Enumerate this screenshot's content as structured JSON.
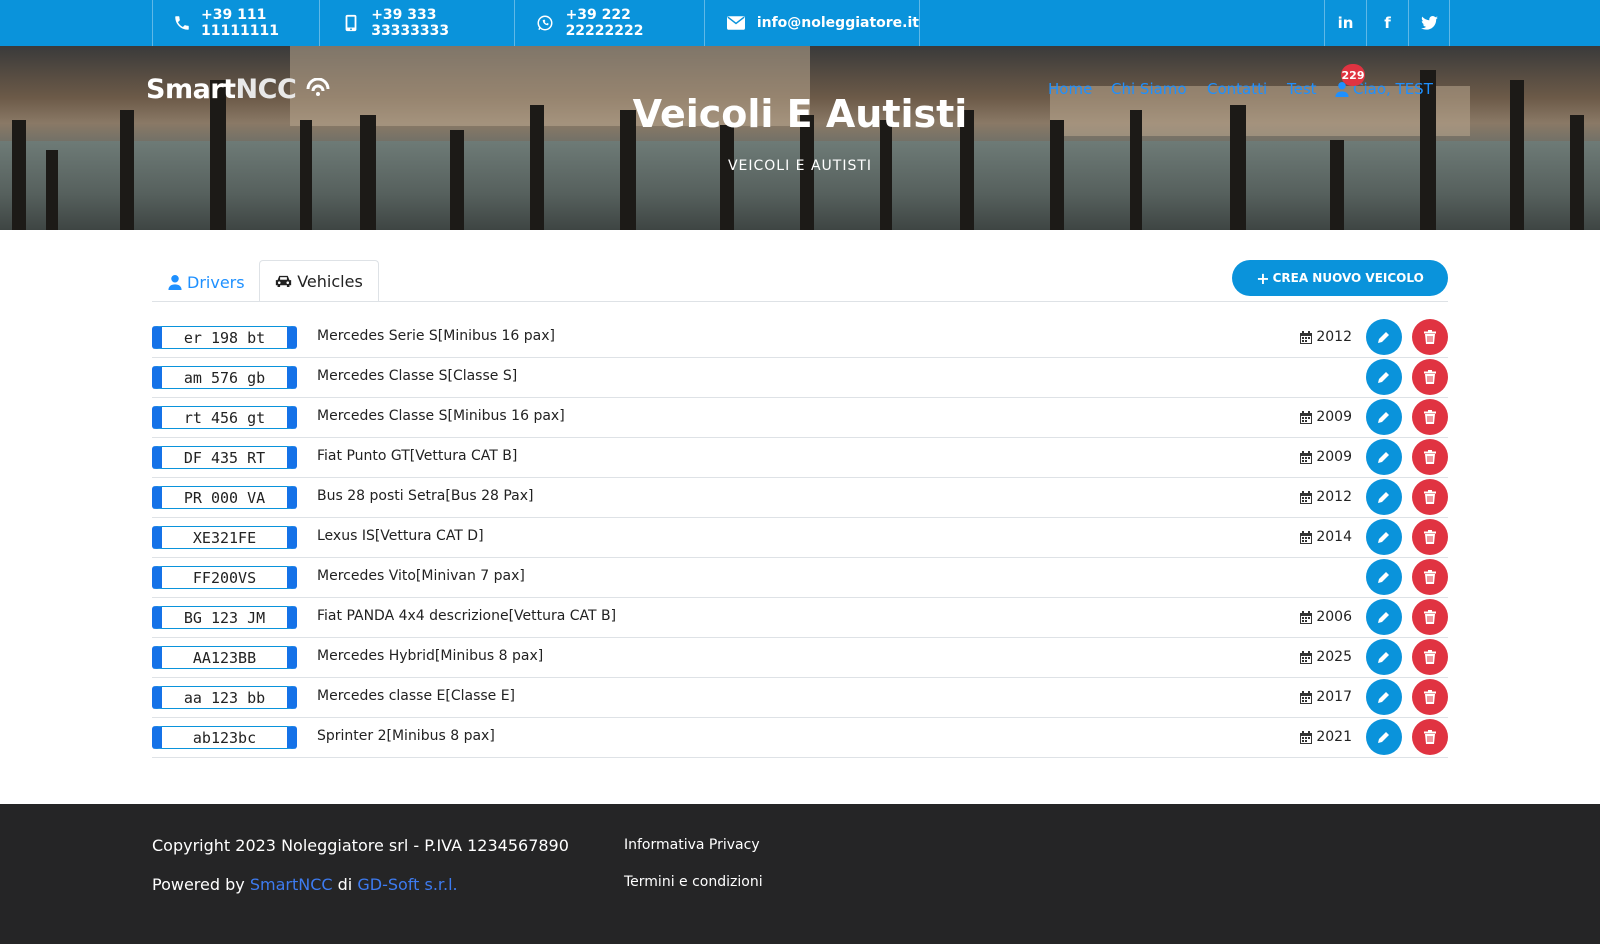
{
  "topbar": {
    "phone": "+39 111 11111111",
    "mobile": "+39 333 33333333",
    "whatsapp": "+39 222 22222222",
    "email": "info@noleggiatore.it",
    "social": [
      "in",
      "f",
      "twitter-icon"
    ]
  },
  "brand": {
    "logo_main": "Smart",
    "logo_accent": "NCC"
  },
  "hero": {
    "title": "Veicoli E Autisti",
    "subtitle": "VEICOLI E AUTISTI"
  },
  "nav": {
    "items": [
      "Home",
      "Chi Siamo",
      "Contatti",
      "Test"
    ],
    "user_label": "Ciao, TEST",
    "notification_count": "229"
  },
  "tabs": {
    "drivers": "Drivers",
    "vehicles": "Vehicles"
  },
  "actions": {
    "create_vehicle": "CREA NUOVO VEICOLO"
  },
  "vehicles": [
    {
      "plate": "er 198 bt",
      "name": "Mercedes Serie S[Minibus 16 pax]",
      "year": "2012"
    },
    {
      "plate": "am 576 gb",
      "name": "Mercedes Classe S[Classe S]",
      "year": ""
    },
    {
      "plate": "rt 456 gt",
      "name": "Mercedes Classe S[Minibus 16 pax]",
      "year": "2009"
    },
    {
      "plate": "DF 435 RT",
      "name": "Fiat Punto GT[Vettura CAT B]",
      "year": "2009"
    },
    {
      "plate": "PR 000 VA",
      "name": "Bus 28 posti Setra[Bus 28 Pax]",
      "year": "2012"
    },
    {
      "plate": "XE321FE",
      "name": "Lexus IS[Vettura CAT D]",
      "year": "2014"
    },
    {
      "plate": "FF200VS",
      "name": "Mercedes Vito[Minivan 7 pax]",
      "year": ""
    },
    {
      "plate": "BG 123 JM",
      "name": "Fiat PANDA 4x4 descrizione[Vettura CAT B]",
      "year": "2006"
    },
    {
      "plate": "AA123BB",
      "name": "Mercedes Hybrid[Minibus 8 pax]",
      "year": "2025"
    },
    {
      "plate": "aa 123 bb",
      "name": "Mercedes classe E[Classe E]",
      "year": "2017"
    },
    {
      "plate": "ab123bc",
      "name": "Sprinter 2[Minibus 8 pax]",
      "year": "2021"
    }
  ],
  "footer": {
    "copyright": "Copyright 2023 Noleggiatore srl - P.IVA 1234567890",
    "powered_prefix": "Powered by",
    "powered_link1": "SmartNCC",
    "powered_mid": "di",
    "powered_link2": "GD-Soft s.r.l.",
    "privacy": "Informativa Privacy",
    "terms": "Termini e condizioni"
  },
  "colors": {
    "primary": "#0a93db",
    "danger": "#e03341",
    "footer_bg": "#252526",
    "nav_link": "#1e90ff"
  }
}
